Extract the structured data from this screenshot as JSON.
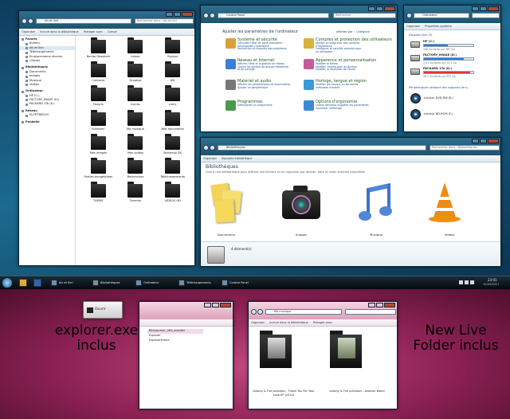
{
  "explorer": {
    "address": "dis et livri",
    "search": "Rechercher dans : dis et livri",
    "toolbar": [
      "Organiser",
      "Inclure dans la bibliothèque",
      "Partager avec",
      "Graver"
    ],
    "nav": [
      {
        "label": "Favoris",
        "kind": "head"
      },
      {
        "label": "Bureau",
        "kind": "sub"
      },
      {
        "label": "dis et livri",
        "kind": "sub"
      },
      {
        "label": "Téléchargements",
        "kind": "sub"
      },
      {
        "label": "Emplacements récents",
        "kind": "sub"
      },
      {
        "label": "Lilipsas",
        "kind": "sub"
      },
      {
        "label": "Bibliothèques",
        "kind": "head-gap"
      },
      {
        "label": "Documents",
        "kind": "sub"
      },
      {
        "label": "Images",
        "kind": "sub"
      },
      {
        "label": "Musique",
        "kind": "sub"
      },
      {
        "label": "Vidéos",
        "kind": "sub"
      },
      {
        "label": "Ordinateur",
        "kind": "head-gap"
      },
      {
        "label": "HP (C:)",
        "kind": "sub"
      },
      {
        "label": "FACTORY_IMAGE (D:)",
        "kind": "sub"
      },
      {
        "label": "PACKARD 1To (K:)",
        "kind": "sub"
      },
      {
        "label": "Réseau",
        "kind": "head-gap"
      },
      {
        "label": "ELOÈTBEN-PC",
        "kind": "sub"
      },
      {
        "label": "Poubelle",
        "kind": "head-gap"
      }
    ],
    "folders": [
      "Bande Dessinée",
      "bimeo",
      "Bureau",
      "Contacts",
      "Dropbox",
      "élé",
      "Favoris",
      "Icones",
      "Liens",
      "livériider",
      "Ma musique",
      "Mes documents",
      "Mes images",
      "Mes vidéos",
      "Nintendo DS",
      "Parties enregistrées",
      "Recherches",
      "Téléchargements",
      "THEME",
      "Torrents",
      "VIDEOS HD"
    ]
  },
  "control_panel": {
    "address": "Control Panel",
    "search": "Rechercher",
    "heading": "Ajuster les paramètres de l'ordinateur",
    "view_label": "Afficher par :",
    "view_value": "Catégorie",
    "left": [
      {
        "title": "Système et sécurité",
        "subs": [
          "Consulter l'état de votre ordinateur",
          "Sauvegarder l'ordinateur",
          "Rechercher et résoudre des problèmes"
        ]
      },
      {
        "title": "Réseau et Internet",
        "subs": [
          "Afficher l'état et la gestion du réseau",
          "Choisir les options de groupe résidentiel",
          "et de partage"
        ]
      },
      {
        "title": "Matériel et audio",
        "subs": [
          "Afficher les périphériques et imprimantes",
          "Ajouter un périphérique"
        ]
      },
      {
        "title": "Programmes",
        "subs": [
          "Désinstaller un programme"
        ]
      }
    ],
    "right": [
      {
        "title": "Comptes et protection des utilisateurs",
        "subs": [
          "Ajouter ou supprimer des comptes",
          "d'utilisateurs",
          "Configurer le contrôle parental pour",
          "un utilisateur"
        ]
      },
      {
        "title": "Apparence et personnalisation",
        "subs": [
          "Modifier le thème",
          "Modifier l'arrière-plan du Bureau",
          "Modifier la résolution de l'écran"
        ]
      },
      {
        "title": "Horloge, langue et région",
        "subs": [
          "Modifier les claviers ou les autres",
          "méthodes d'entrée"
        ]
      },
      {
        "title": "Options d'ergonomie",
        "subs": [
          "Laisser Windows suggérer les paramètres",
          "Optimiser l'affichage"
        ]
      }
    ]
  },
  "computer": {
    "address": "Ordinateur",
    "toolbar": [
      "Organiser",
      "Propriétés système"
    ],
    "hdd_group": "Disques durs (3)",
    "drives": [
      {
        "name": "HP (C:)",
        "free": "190 Go libres sur 367 Go",
        "used_fraction": 0.48,
        "color": "#2e7ad1"
      },
      {
        "name": "FACTORY_IMAGE (D:)",
        "free": "2,91 Go libres sur 15,3 Go",
        "used_fraction": 0.81,
        "color": "#2e7ad1"
      },
      {
        "name": "PACKARD 1To (K:)",
        "free": "56,1 Go libres sur 931 Go",
        "used_fraction": 0.94,
        "color": "#d43b3b"
      }
    ],
    "removable_group": "Périphériques utilisant des supports de s...",
    "removables": [
      "Lecteur DVD RW (E:)",
      "Lecteur BD-ROM (F:)"
    ]
  },
  "libraries": {
    "address": "Bibliothèques",
    "search": "Rechercher dans : Bibliothèques",
    "toolbar": [
      "Organiser",
      "Nouvelle bibliothèque"
    ],
    "title": "Bibliothèques",
    "subtitle": "Ouvrir une bibliothèque pour afficher vos fichiers et les organiser par dossier, date et selon d'autres propriétés.",
    "items": [
      "Documents",
      "Images",
      "Musique",
      "Vidéos"
    ],
    "status": "4 élément(s)"
  },
  "taskbar": {
    "items": [
      "dis et livri",
      "Bibliothèques",
      "Ordinateur",
      "Téléchargements",
      "Control Panel"
    ],
    "time": "23:01",
    "date": "15/05/2011"
  },
  "small_explorer": {
    "title": "Ouvrir",
    "items": [
      "Bitmaprmer_064_installer",
      "Explorer",
      "ExplorerFrame"
    ]
  },
  "music_window": {
    "address": "Ma musique",
    "toolbar": [
      "Organiser",
      "Inclure dans la bibliothèque",
      "Partager avec"
    ],
    "albums": [
      "Antony & The Johnsons - Thank You For Your Love EP (2010)",
      "Antony & The Johnsons - Another World"
    ]
  },
  "captions": {
    "left": "explorer.exe inclus",
    "right": "New Live Folder inclus"
  }
}
